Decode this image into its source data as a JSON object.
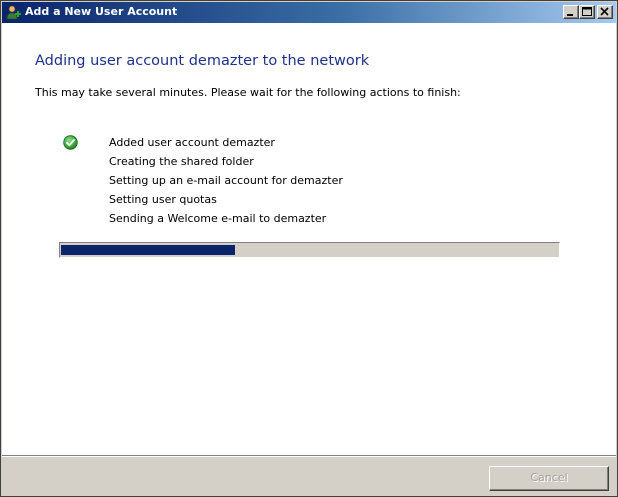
{
  "window": {
    "title": "Add a New User Account"
  },
  "content": {
    "heading": "Adding user account demazter to the network",
    "subtitle": "This may take several minutes. Please wait for the following actions to finish:",
    "actions": [
      {
        "label": "Added user account demazter",
        "status": "done"
      },
      {
        "label": "Creating the shared folder",
        "status": "pending"
      },
      {
        "label": "Setting up an e-mail account for demazter",
        "status": "pending"
      },
      {
        "label": "Setting user quotas",
        "status": "pending"
      },
      {
        "label": "Sending a Welcome e-mail to demazter",
        "status": "pending"
      }
    ],
    "progress_percent": 35
  },
  "footer": {
    "cancel_label": "Cancel",
    "cancel_enabled": false
  },
  "colors": {
    "heading": "#1e3287",
    "progress_fill": "#0a246a",
    "check": "#2e9e2e"
  },
  "icons": {
    "title": "user-account-icon",
    "done": "check-circle-icon"
  }
}
